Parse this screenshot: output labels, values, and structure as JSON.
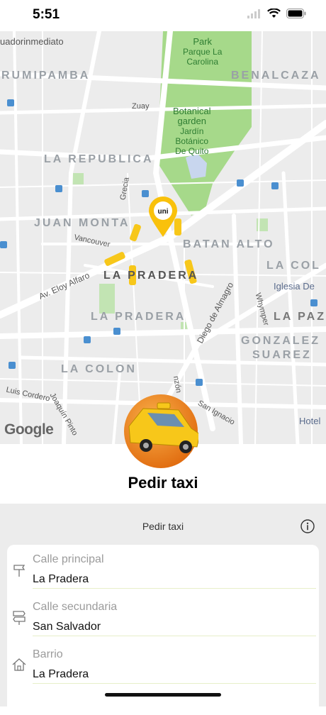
{
  "status": {
    "time": "5:51"
  },
  "map": {
    "districts": [
      "RUMIPAMBA",
      "BENALCAZA",
      "LA REPUBLICA",
      "JUAN MONTA",
      "BATAN ALTO",
      "LA COL",
      "LA PRADERA",
      "LA PRADERA",
      "LA PAZ",
      "GONZALEZ",
      "SUAREZ",
      "LA COLON"
    ],
    "streets": [
      "uadorinmediato",
      "Zuay",
      "Av. Eloy Alfaro",
      "Vancouver",
      "Grecia",
      "Diego de Almagro",
      "Whymper",
      "Luis Cordero",
      "Joaquín Pinto",
      "San Ignacio",
      "nzón"
    ],
    "park": {
      "name": "Park",
      "sub1": "Parque La",
      "sub2": "Carolina"
    },
    "garden": {
      "l1": "Botanical",
      "l2": "garden",
      "l3": "Jardín",
      "l4": "Botánico",
      "l5": "De Quito"
    },
    "places": {
      "church": "Iglesia De",
      "hotel": "Hotel"
    },
    "google": "Google",
    "pin_text": "uni"
  },
  "title": "Pedir taxi",
  "form": {
    "header": "Pedir taxi",
    "fields": [
      {
        "label": "Calle principal",
        "value": "La Pradera",
        "icon": "signpost-icon"
      },
      {
        "label": "Calle secundaria",
        "value": "San Salvador",
        "icon": "directions-sign-icon"
      },
      {
        "label": "Barrio",
        "value": "La Pradera",
        "icon": "home-icon"
      }
    ]
  },
  "colors": {
    "park_green": "#a6d98a",
    "taxi_yellow": "#f7c71a",
    "badge_orange": "#f08a1a",
    "line_green": "#e7efc9"
  }
}
